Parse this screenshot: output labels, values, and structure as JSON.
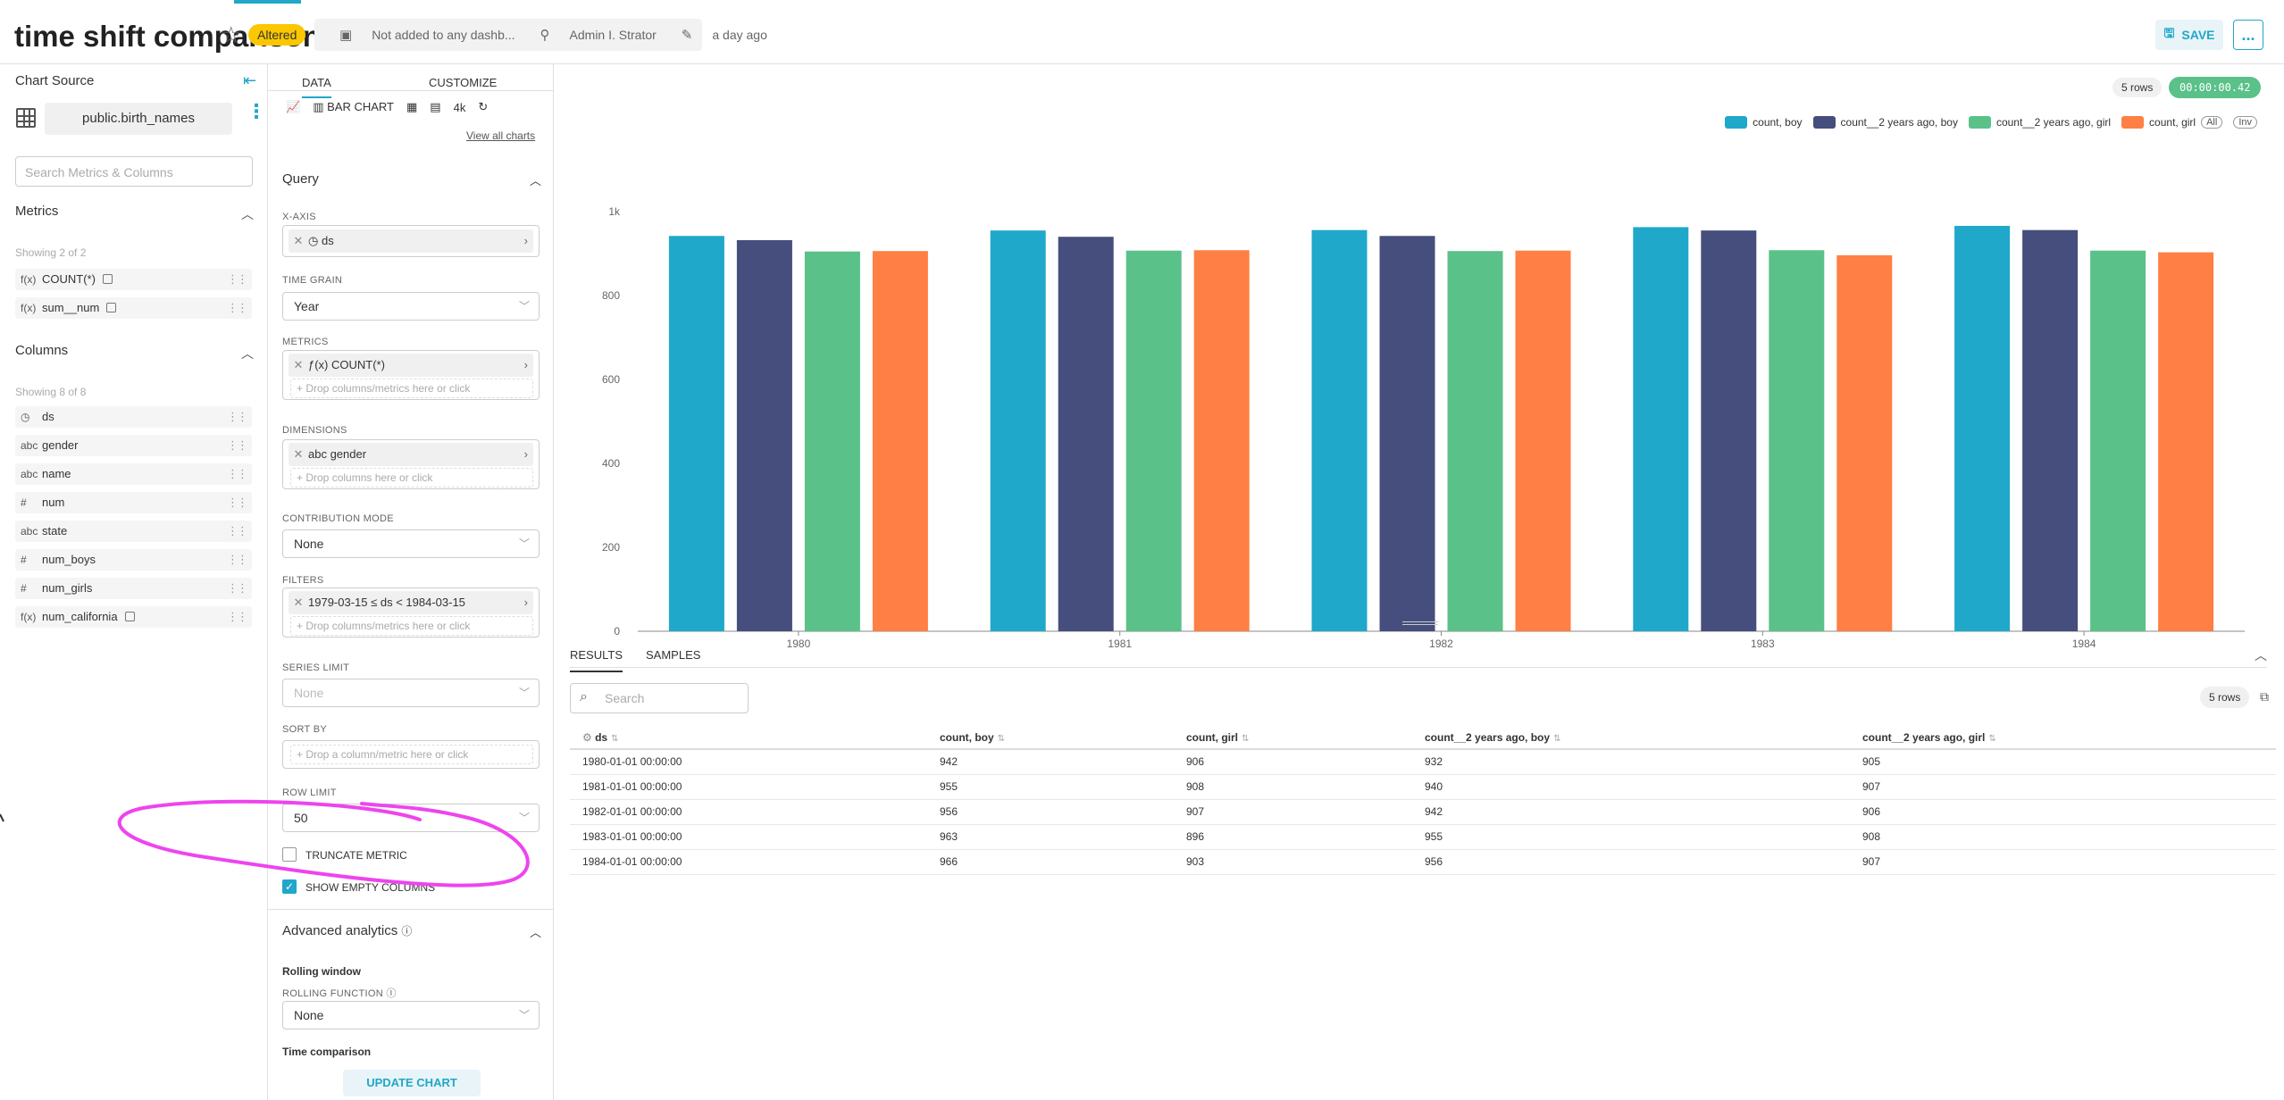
{
  "header": {
    "title": "time shift comparison",
    "badge": "Altered",
    "dashboards": "Not added to any dashb...",
    "owner": "Admin I. Strator",
    "modified": "a day ago",
    "save_label": "SAVE",
    "more_label": "..."
  },
  "datasource_panel": {
    "title": "Chart Source",
    "dataset": "public.birth_names",
    "search_placeholder": "Search Metrics & Columns",
    "metrics_title": "Metrics",
    "metrics_showing": "Showing 2 of 2",
    "metrics": [
      {
        "type": "f(x)",
        "name": "COUNT(*)"
      },
      {
        "type": "f(x)",
        "name": "sum__num"
      }
    ],
    "columns_title": "Columns",
    "columns_showing": "Showing 8 of 8",
    "columns": [
      {
        "type": "clock",
        "name": "ds"
      },
      {
        "type": "abc",
        "name": "gender"
      },
      {
        "type": "abc",
        "name": "name"
      },
      {
        "type": "#",
        "name": "num"
      },
      {
        "type": "abc",
        "name": "state"
      },
      {
        "type": "#",
        "name": "num_boys"
      },
      {
        "type": "#",
        "name": "num_girls"
      },
      {
        "type": "f(x)",
        "name": "num_california"
      }
    ]
  },
  "control_panel": {
    "tab_data": "DATA",
    "tab_customize": "CUSTOMIZE",
    "viz_selected": "BAR CHART",
    "viz_4k": "4k",
    "view_all": "View all charts",
    "query_title": "Query",
    "x_axis_label": "X-AXIS",
    "x_axis_value": "ds",
    "time_grain_label": "TIME GRAIN",
    "time_grain_value": "Year",
    "metrics_label": "METRICS",
    "metrics_value": "COUNT(*)",
    "metrics_drop": "Drop columns/metrics here or click",
    "dimensions_label": "DIMENSIONS",
    "dimensions_value": "gender",
    "dimensions_drop": "Drop columns here or click",
    "contribution_label": "CONTRIBUTION MODE",
    "contribution_value": "None",
    "filters_label": "FILTERS",
    "filters_value": "1979-03-15 ≤ ds < 1984-03-15",
    "filters_drop": "Drop columns/metrics here or click",
    "series_limit_label": "SERIES LIMIT",
    "series_limit_value": "None",
    "sort_by_label": "SORT BY",
    "sort_by_drop": "Drop a column/metric here or click",
    "row_limit_label": "ROW LIMIT",
    "row_limit_value": "50",
    "truncate_label": "TRUNCATE METRIC",
    "truncate_checked": false,
    "show_empty_label": "SHOW EMPTY COLUMNS",
    "show_empty_checked": true,
    "advanced_title": "Advanced analytics",
    "rolling_window": "Rolling window",
    "rolling_function_label": "ROLLING FUNCTION",
    "rolling_function_value": "None",
    "time_comparison": "Time comparison",
    "update_label": "UPDATE CHART"
  },
  "chart_panel": {
    "rows": "5 rows",
    "timer": "00:00:00.42",
    "legend_all": "All",
    "legend_inv": "Inv"
  },
  "chart_data": {
    "type": "bar",
    "categories": [
      "1980",
      "1981",
      "1982",
      "1983",
      "1984"
    ],
    "series": [
      {
        "name": "count, boy",
        "color": "#1fa8c9",
        "values": [
          942,
          955,
          956,
          963,
          966
        ]
      },
      {
        "name": "count__2 years ago, boy",
        "color": "#454e7c",
        "values": [
          932,
          940,
          942,
          955,
          956
        ]
      },
      {
        "name": "count__2 years ago, girl",
        "color": "#5ac189",
        "values": [
          905,
          907,
          906,
          908,
          907
        ]
      },
      {
        "name": "count, girl",
        "color": "#ff7f44",
        "values": [
          906,
          908,
          907,
          896,
          903
        ]
      }
    ],
    "yticks": [
      "0",
      "200",
      "400",
      "600",
      "800",
      "1k"
    ],
    "ylim": [
      0,
      1000
    ],
    "grid": false,
    "legend": "top-right"
  },
  "results": {
    "tab_results": "RESULTS",
    "tab_samples": "SAMPLES",
    "search_placeholder": "Search",
    "rows": "5 rows",
    "columns": [
      "ds",
      "count, boy",
      "count, girl",
      "count__2 years ago, boy",
      "count__2 years ago, girl"
    ],
    "data": [
      [
        "1980-01-01 00:00:00",
        "942",
        "906",
        "932",
        "905"
      ],
      [
        "1981-01-01 00:00:00",
        "955",
        "908",
        "940",
        "907"
      ],
      [
        "1982-01-01 00:00:00",
        "956",
        "907",
        "942",
        "906"
      ],
      [
        "1983-01-01 00:00:00",
        "963",
        "896",
        "955",
        "908"
      ],
      [
        "1984-01-01 00:00:00",
        "966",
        "903",
        "956",
        "907"
      ]
    ]
  },
  "colors": {
    "accent": "#20a7c9",
    "badge": "#fbc700",
    "annotation": "#ee44ee"
  }
}
